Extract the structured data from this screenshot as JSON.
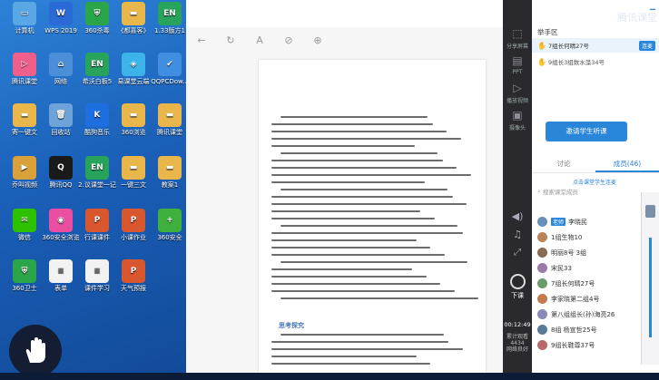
{
  "desktop": {
    "icons": [
      {
        "label": "计算机",
        "icon": "computer-icon",
        "color": "#5aa7e6",
        "glyph": "▭"
      },
      {
        "label": "WPS 2019",
        "icon": "wps-icon",
        "color": "#2b69d6",
        "glyph": "W"
      },
      {
        "label": "360杀毒",
        "icon": "shield-360-icon",
        "color": "#2aa54a",
        "glyph": "⛨"
      },
      {
        "label": "《都喜客》",
        "icon": "folder-icon",
        "color": "#e8b64a",
        "glyph": "▬"
      },
      {
        "label": "1.33版方1",
        "icon": "en-app-icon",
        "color": "#27a35b",
        "glyph": "EN"
      },
      {
        "label": "腾讯课堂",
        "icon": "cloud-app-icon",
        "color": "#ef5f8b",
        "glyph": "▷"
      },
      {
        "label": "网络",
        "icon": "network-icon",
        "color": "#4a8fd8",
        "glyph": "⌂"
      },
      {
        "label": "希沃白板5",
        "icon": "en-app-icon",
        "color": "#27a35b",
        "glyph": "EN"
      },
      {
        "label": "易课堂云端",
        "icon": "app-icon",
        "color": "#3cb4ea",
        "glyph": "◈"
      },
      {
        "label": "QQPCDow...",
        "icon": "qqpc-icon",
        "color": "#3f8ee0",
        "glyph": "✔"
      },
      {
        "label": "寄一键文",
        "icon": "folder-icon",
        "color": "#e8b64a",
        "glyph": "▬"
      },
      {
        "label": "回收站",
        "icon": "recycle-bin-icon",
        "color": "#6da3d8",
        "glyph": "🗑"
      },
      {
        "label": "酷狗音乐",
        "icon": "kugou-icon",
        "color": "#1d6fe0",
        "glyph": "K"
      },
      {
        "label": "360浏览",
        "icon": "folder-icon",
        "color": "#e8b64a",
        "glyph": "▬"
      },
      {
        "label": "腾讯课堂",
        "icon": "folder-icon",
        "color": "#e8b64a",
        "glyph": "▬"
      },
      {
        "label": "乔叫视频",
        "icon": "video-icon",
        "color": "#d8a13a",
        "glyph": "▶"
      },
      {
        "label": "腾讯QQ",
        "icon": "qq-icon",
        "color": "#1a1a1a",
        "glyph": "Q"
      },
      {
        "label": "2.议课堂一记",
        "icon": "en-app-icon",
        "color": "#27a35b",
        "glyph": "EN"
      },
      {
        "label": "一键三文",
        "icon": "folder-icon",
        "color": "#e8b64a",
        "glyph": "▬"
      },
      {
        "label": "教案1",
        "icon": "folder-icon",
        "color": "#e8b64a",
        "glyph": "▬"
      },
      {
        "label": "微信",
        "icon": "wechat-icon",
        "color": "#2dc100",
        "glyph": "✉"
      },
      {
        "label": "360安全浏览",
        "icon": "color-wheel-icon",
        "color": "#e94ea1",
        "glyph": "◉"
      },
      {
        "label": "行课课件",
        "icon": "ppt-icon",
        "color": "#d9572e",
        "glyph": "P"
      },
      {
        "label": "小课作业",
        "icon": "ppt-icon",
        "color": "#d9572e",
        "glyph": "P"
      },
      {
        "label": "360安全",
        "icon": "plus-icon",
        "color": "#3db03d",
        "glyph": "+"
      },
      {
        "label": "360卫士",
        "icon": "shield-360-icon",
        "color": "#2aa54a",
        "glyph": "⛨"
      },
      {
        "label": "表单",
        "icon": "doc-icon",
        "color": "#f2f2f2",
        "glyph": "≡"
      },
      {
        "label": "课件学习",
        "icon": "doc-icon",
        "color": "#f2f2f2",
        "glyph": "≡"
      },
      {
        "label": "天气预报",
        "icon": "ppt-icon",
        "color": "#d9572e",
        "glyph": "P"
      }
    ]
  },
  "viewer": {
    "tools": [
      "back-icon",
      "redo-icon",
      "text-icon",
      "link-icon",
      "cursor-icon"
    ],
    "tool_glyphs": [
      "←",
      "↻",
      "A",
      "⊘",
      "⊕"
    ],
    "doc_heading": "思考探究"
  },
  "toolcolumn": {
    "items": [
      {
        "label": "分享屏幕",
        "icon": "share-screen-icon",
        "glyph": "⬚"
      },
      {
        "label": "PPT",
        "icon": "ppt-icon",
        "glyph": "▤"
      },
      {
        "label": "播放视频",
        "icon": "play-video-icon",
        "glyph": "▷"
      },
      {
        "label": "摄像头",
        "icon": "camera-icon",
        "glyph": "▣"
      }
    ],
    "timer": "00:12:49",
    "leave_label": "下课",
    "status_lines": [
      "累计观看",
      "4434",
      "网络良好"
    ]
  },
  "panel": {
    "section_title": "举手区",
    "raise_hand_1": "7组长何晴27号",
    "raise_hand_2": "9组长3组数水藻34号",
    "connect_label": "连麦",
    "invite_label": "邀请学生听课",
    "tabs": [
      "讨论",
      "成员(46)"
    ],
    "hint": "点击课堂学生连麦",
    "search_placeholder": "搜索课堂成员",
    "teacher_badge": "老师",
    "members": [
      {
        "name": "李晓民",
        "color": "#6c8fb8"
      },
      {
        "name": "1组生物10",
        "color": "#b9845a"
      },
      {
        "name": "明丽8号 3组",
        "color": "#8a6b52"
      },
      {
        "name": "宋民33",
        "color": "#9a7aa8"
      },
      {
        "name": "7组长何晴27号",
        "color": "#6b9b6b"
      },
      {
        "name": "李家晓第二组4号",
        "color": "#c27a4f"
      },
      {
        "name": "第八组组长(孙)海亮26",
        "color": "#8a8ab8"
      },
      {
        "name": "8组 杨宣哲25号",
        "color": "#5a7a9a"
      },
      {
        "name": "9组长鞋尊37号",
        "color": "#b86a6a"
      }
    ],
    "header_title": "腾讯课堂"
  }
}
